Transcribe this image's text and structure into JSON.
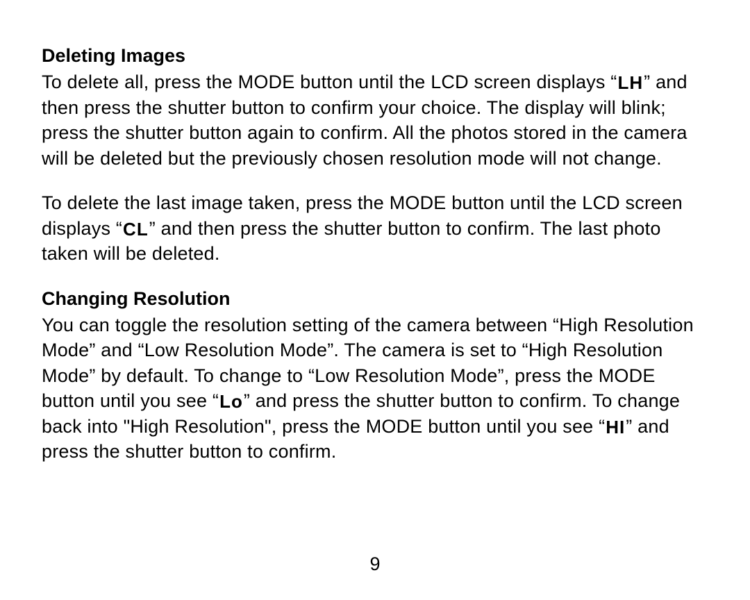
{
  "sections": {
    "deleting": {
      "heading": "Deleting Images",
      "p1a": "To delete all, press the MODE button until the LCD screen displays “",
      "p1_icon": "LH",
      "p1b": "” and then press the shutter button to confirm your choice.  The display will blink; press the shutter button again to confirm.  All the photos stored in the camera will be deleted but the previously chosen resolution mode will not change.",
      "p2a": "To delete the last image taken, press the MODE button until the LCD screen displays  “",
      "p2_icon": "CL",
      "p2b": "”   and then press the shutter button to confirm.  The last photo taken will be deleted."
    },
    "resolution": {
      "heading": "Changing Resolution",
      "p1a": "You can toggle the resolution setting of the camera between “High Resolution Mode” and “Low Resolution Mode”.  The camera is set to “High Resolution Mode” by default.  To change to “Low Resolution Mode”, press the MODE button until you see “",
      "p1_icon1": "Lo",
      "p1b": "”  and press the shutter button to confirm.  To change back into \"High Resolution\", press the MODE button until you see  “",
      "p1_icon2": "HI",
      "p1c": "”  and press the shutter button to confirm."
    }
  },
  "page_number": "9"
}
